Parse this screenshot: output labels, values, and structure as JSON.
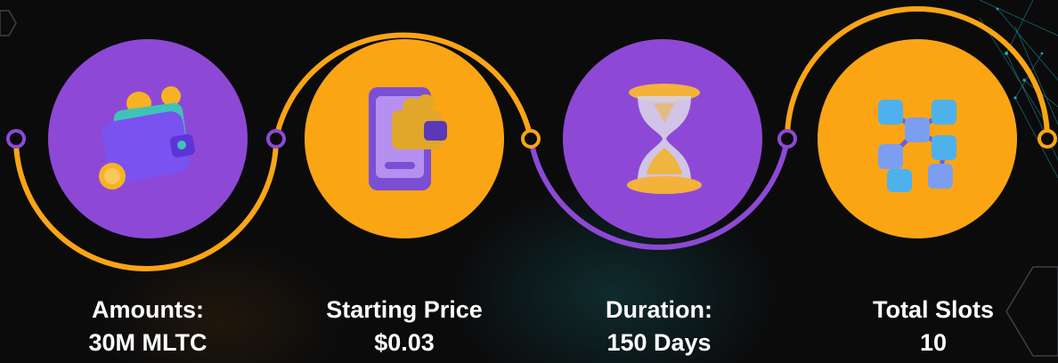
{
  "colors": {
    "background": "#0b0b0c",
    "purple": "#8d49d6",
    "orange": "#fba515",
    "text": "#ffffff",
    "network_lines": "#27c6d9"
  },
  "stats": [
    {
      "title": "Amounts:",
      "value": "30M MLTC",
      "icon": "wallet-coins-icon",
      "circle_color": "purple"
    },
    {
      "title": "Starting Price",
      "value": "$0.03",
      "icon": "phone-wallet-coins-icon",
      "circle_color": "orange"
    },
    {
      "title": "Duration:",
      "value": "150 Days",
      "icon": "hourglass-icon",
      "circle_color": "purple"
    },
    {
      "title": "Total Slots",
      "value": "10",
      "icon": "blockchain-cubes-icon",
      "circle_color": "orange"
    }
  ]
}
